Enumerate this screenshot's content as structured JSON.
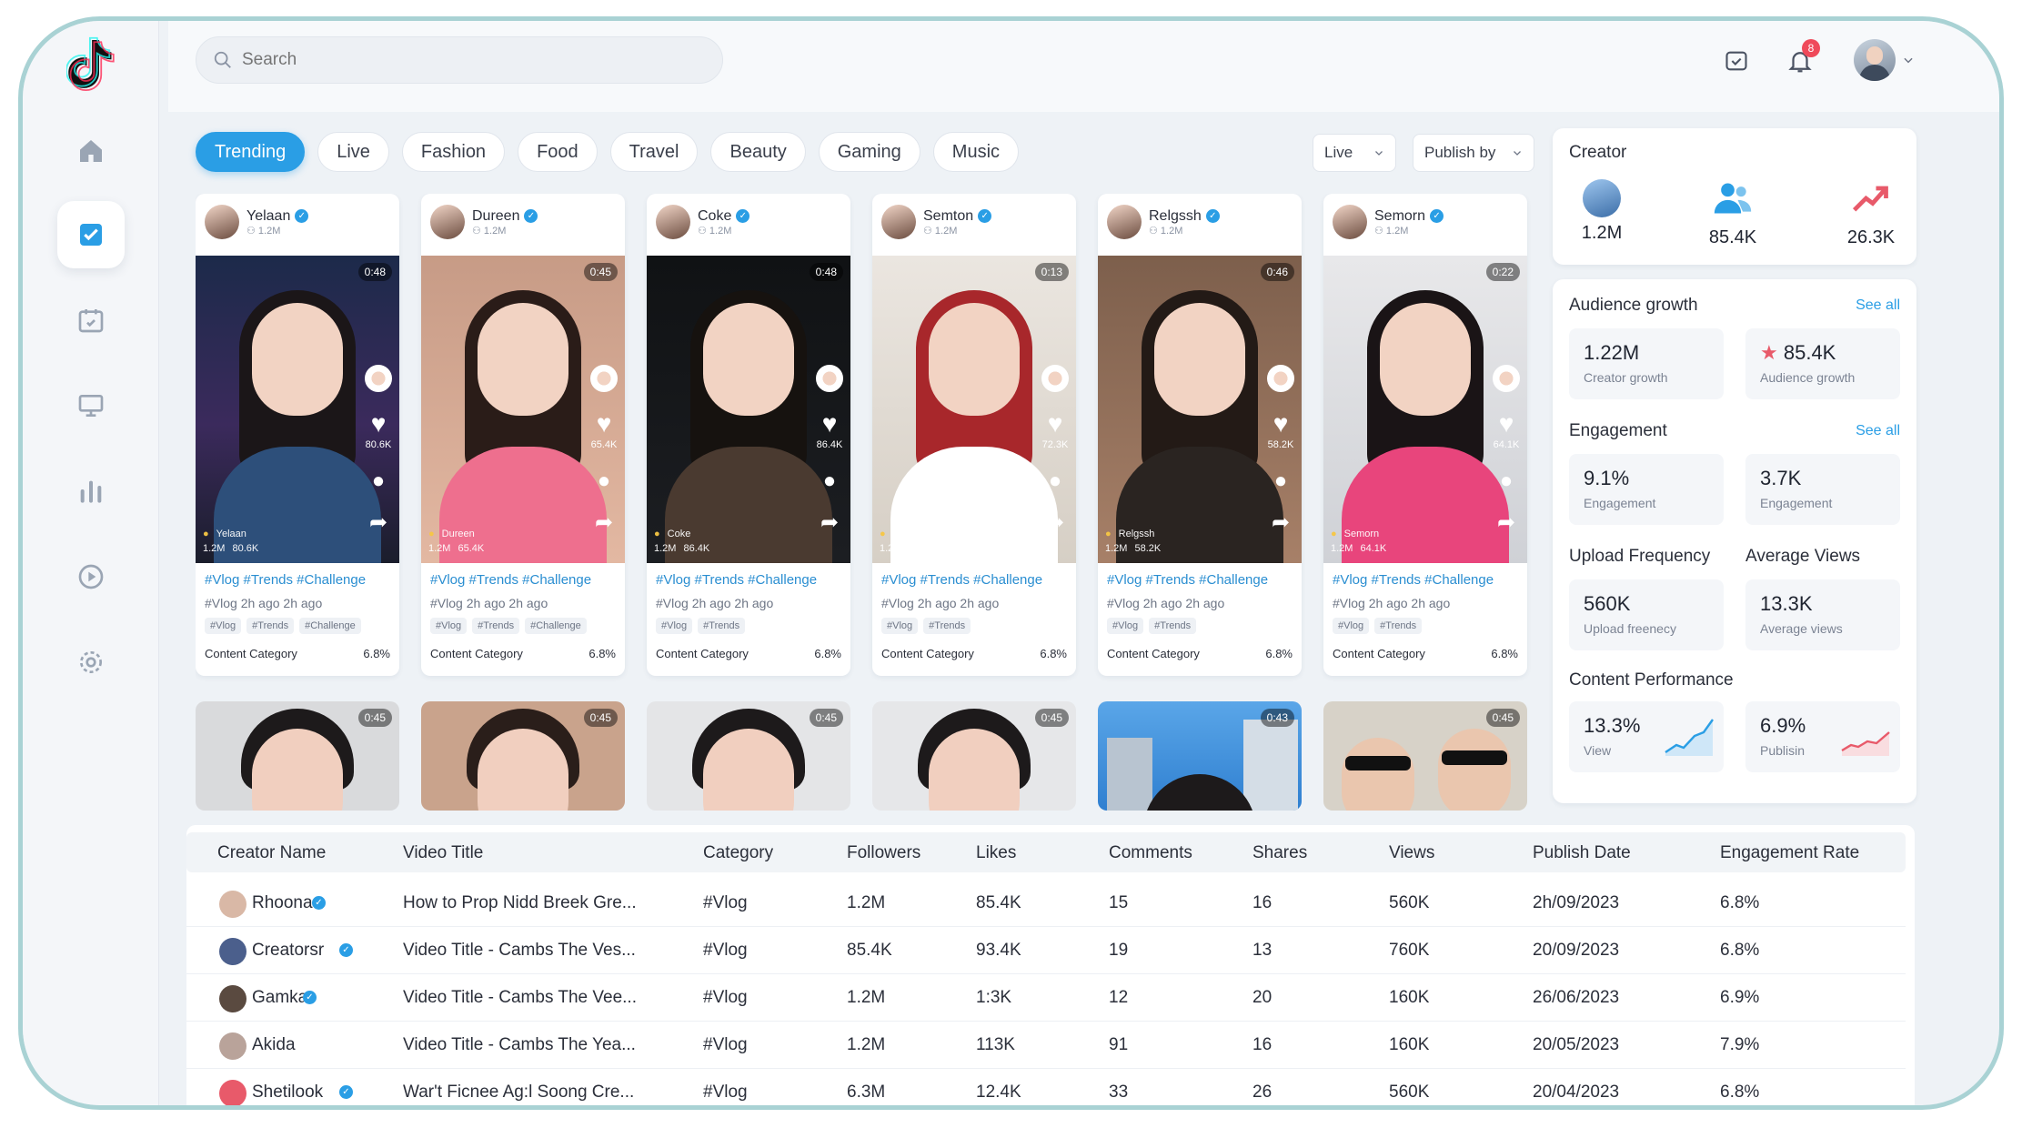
{
  "search": {
    "placeholder": "Search"
  },
  "header": {
    "notification_count": "8"
  },
  "filters": {
    "chips": [
      "Trending",
      "Live",
      "Fashion",
      "Food",
      "Travel",
      "Beauty",
      "Gaming",
      "Music"
    ],
    "active": "Trending",
    "live_select": "Live",
    "publish_select": "Publish by"
  },
  "videos": [
    {
      "name": "Yelaan",
      "followers": "1.2M",
      "duration": "0:48",
      "tags": "#Vlog #Trends #Challenge",
      "meta": "#Vlog  2h ago  2h ago",
      "chips": [
        "#Vlog",
        "#Trends",
        "#Challenge"
      ],
      "category": "Content Category",
      "rate": "6.8%",
      "likes": "80.6K"
    },
    {
      "name": "Dureen",
      "followers": "1.2M",
      "duration": "0:45",
      "tags": "#Vlog #Trends #Challenge",
      "meta": "#Vlog  2h ago  2h ago",
      "chips": [
        "#Vlog",
        "#Trends",
        "#Challenge"
      ],
      "category": "Content Category",
      "rate": "6.8%",
      "likes": "65.4K"
    },
    {
      "name": "Coke",
      "followers": "1.2M",
      "duration": "0:48",
      "tags": "#Vlog #Trends #Challenge",
      "meta": "#Vlog  2h ago  2h ago",
      "chips": [
        "#Vlog",
        "#Trends"
      ],
      "category": "Content Category",
      "rate": "6.8%",
      "likes": "86.4K"
    },
    {
      "name": "Semton",
      "followers": "1.2M",
      "duration": "0:13",
      "tags": "#Vlog #Trends #Challenge",
      "meta": "#Vlog  2h ago  2h ago",
      "chips": [
        "#Vlog",
        "#Trends"
      ],
      "category": "Content Category",
      "rate": "6.8%",
      "likes": "72.3K"
    },
    {
      "name": "Relgssh",
      "followers": "1.2M",
      "duration": "0:46",
      "tags": "#Vlog #Trends #Challenge",
      "meta": "#Vlog  2h ago  2h ago",
      "chips": [
        "#Vlog",
        "#Trends"
      ],
      "category": "Content Category",
      "rate": "6.8%",
      "likes": "58.2K"
    },
    {
      "name": "Semorn",
      "followers": "1.2M",
      "duration": "0:22",
      "tags": "#Vlog #Trends #Challenge",
      "meta": "#Vlog  2h ago  2h ago",
      "chips": [
        "#Vlog",
        "#Trends"
      ],
      "category": "Content Category",
      "rate": "6.8%",
      "likes": "64.1K"
    }
  ],
  "videos_row2": [
    "0:45",
    "0:45",
    "0:45",
    "0:45",
    "0:43",
    "0:45"
  ],
  "creator": {
    "title": "Creator",
    "stats": [
      "1.2M",
      "85.4K",
      "26.3K"
    ]
  },
  "audience_growth": {
    "title": "Audience growth",
    "see_all": "See all",
    "tiles": [
      {
        "value": "1.22M",
        "label": "Creator growth"
      },
      {
        "value": "85.4K",
        "label": "Audience growth"
      }
    ]
  },
  "engagement": {
    "title": "Engagement",
    "see_all": "See all",
    "tiles": [
      {
        "value": "9.1%",
        "label": "Engagement"
      },
      {
        "value": "3.7K",
        "label": "Engagement"
      }
    ]
  },
  "upload": {
    "title_left": "Upload Frequency",
    "title_right": "Average Views",
    "tiles": [
      {
        "value": "560K",
        "label": "Upload freenecy"
      },
      {
        "value": "13.3K",
        "label": "Average views"
      }
    ]
  },
  "performance": {
    "title": "Content Performance",
    "tiles": [
      {
        "value": "13.3%",
        "label": "View"
      },
      {
        "value": "6.9%",
        "label": "Publisin"
      }
    ]
  },
  "table": {
    "headers": [
      "Creator Name",
      "Video Title",
      "Category",
      "Followers",
      "Likes",
      "Comments",
      "Shares",
      "Views",
      "Publish Date",
      "Engagement Rate"
    ],
    "rows": [
      {
        "creator": "Rhoona",
        "title": "How to Prop Nidd Breek Gre...",
        "category": "#Vlog",
        "followers": "1.2M",
        "likes": "85.4K",
        "comments": "15",
        "shares": "16",
        "views": "560K",
        "date": "2h/09/2023",
        "rate": "6.8%"
      },
      {
        "creator": "Creatorsr",
        "title": "Video Title - Cambs The Ves...",
        "category": "#Vlog",
        "followers": "85.4K",
        "likes": "93.4K",
        "comments": "19",
        "shares": "13",
        "views": "760K",
        "date": "20/09/2023",
        "rate": "6.8%"
      },
      {
        "creator": "Gamka",
        "title": "Video Title - Cambs The Vee...",
        "category": "#Vlog",
        "followers": "1.2M",
        "likes": "1:3K",
        "comments": "12",
        "shares": "20",
        "views": "160K",
        "date": "26/06/2023",
        "rate": "6.9%"
      },
      {
        "creator": "Akida",
        "title": "Video Title - Cambs The Yea...",
        "category": "#Vlog",
        "followers": "1.2M",
        "likes": "113K",
        "comments": "91",
        "shares": "16",
        "views": "160K",
        "date": "20/05/2023",
        "rate": "7.9%"
      },
      {
        "creator": "Shetilook",
        "title": "War't Ficnee Ag:l Soong Cre...",
        "category": "#Vlog",
        "followers": "6.3M",
        "likes": "12.4K",
        "comments": "33",
        "shares": "26",
        "views": "560K",
        "date": "20/04/2023",
        "rate": "6.8%"
      }
    ]
  },
  "colors": {
    "accent": "#2a9ee5",
    "frame": "#a9d2d4",
    "trend_up": "#2a9ee5",
    "trend_down": "#e85a6a"
  }
}
